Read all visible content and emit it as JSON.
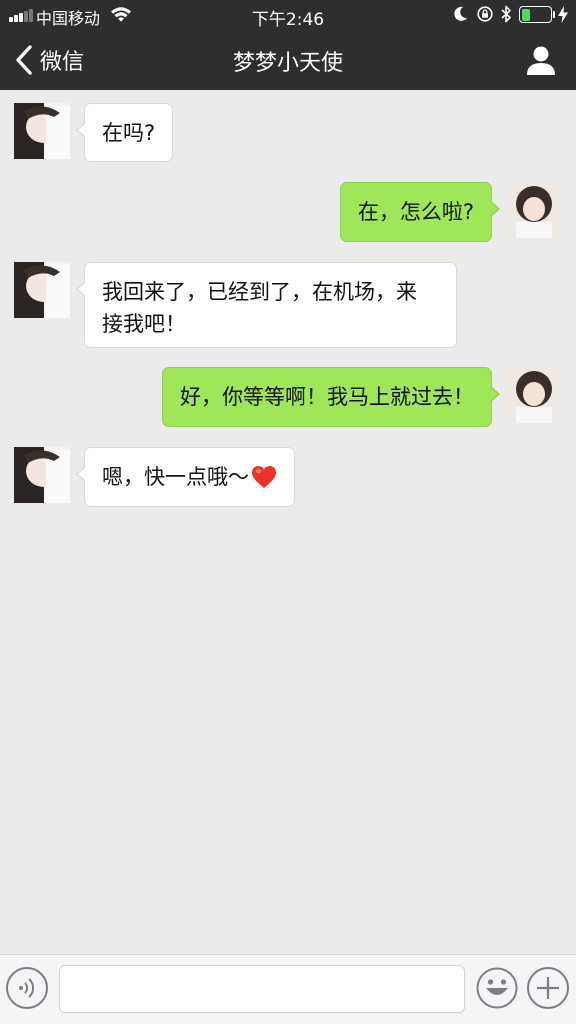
{
  "status_bar": {
    "carrier": "中国移动",
    "time": "下午2:46",
    "battery_level": 0.3
  },
  "nav": {
    "back_label": "微信",
    "title": "梦梦小天使"
  },
  "messages": [
    {
      "side": "in",
      "text": "在吗?"
    },
    {
      "side": "out",
      "text": "在，怎么啦?"
    },
    {
      "side": "in",
      "line1": "我回来了，已经到了，在机场，来",
      "line2": "接我吧！"
    },
    {
      "side": "out",
      "text": "好，你等等啊！我马上就过去！"
    },
    {
      "side": "in",
      "text": "嗯，快一点哦～"
    }
  ],
  "input": {
    "value": "",
    "placeholder": ""
  },
  "colors": {
    "bar_bg": "#2e2e2e",
    "chat_bg": "#ebebeb",
    "outgoing_bubble": "#9fe658",
    "incoming_bubble": "#ffffff",
    "battery_fill": "#4cd964"
  }
}
